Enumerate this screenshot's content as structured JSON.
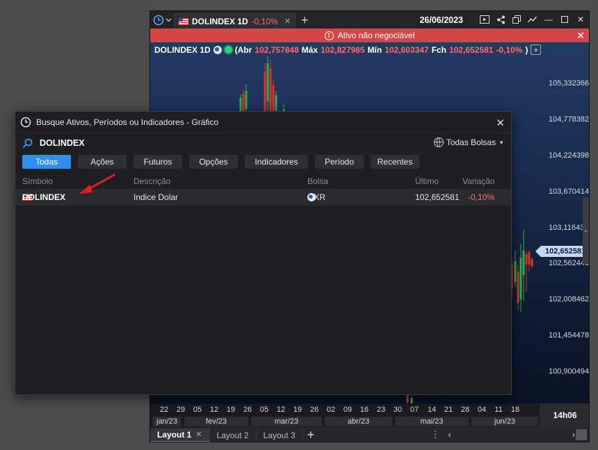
{
  "chart_window": {
    "tab_title": "DOLINDEX 1D",
    "tab_change": "-0,10%",
    "date": "26/06/2023",
    "alert_text": "Ativo não negociável",
    "info": {
      "symbol": "DOLINDEX 1D",
      "open_label": "(Abr",
      "open_value": "102,757848",
      "high_label": "Máx",
      "high_value": "102,827985",
      "low_label": "Mín",
      "low_value": "102,603347",
      "close_label": "Fch",
      "close_value": "102,652581",
      "change": "-0,10%",
      "close_paren": ")"
    },
    "price_axis": [
      "105,332366",
      "104,778382",
      "104,224398",
      "103,670414",
      "103,11643",
      "102,562446",
      "102,008462",
      "101,454478",
      "100,900494"
    ],
    "current_price": "102,652581",
    "day_labels": [
      "22",
      "29",
      "05",
      "12",
      "19",
      "26",
      "05",
      "12",
      "19",
      "26",
      "02",
      "09",
      "16",
      "23",
      "30",
      "07",
      "14",
      "21",
      "28",
      "04",
      "11",
      "18"
    ],
    "month_labels": [
      "jan/23",
      "fev/23",
      "mar/23",
      "abr/23",
      "mai/23",
      "jun/23"
    ],
    "time_box": "14h06",
    "layouts": [
      "Layout 1",
      "Layout 2",
      "Layout 3"
    ],
    "colors": {
      "up": "#2fb24a",
      "down": "#e0312f",
      "accent": "#2f8ff0",
      "alert": "#d64545"
    }
  },
  "search_dialog": {
    "title": "Busque Ativos, Períodos ou Indicadores - Gráfico",
    "search_value": "DOLINDEX",
    "exchange_filter": "Todas Bolsas",
    "filter_tabs": [
      "Todas",
      "Ações",
      "Futuros",
      "Opções",
      "Indicadores",
      "Período",
      "Recentes"
    ],
    "columns": {
      "symbol": "Símbolo",
      "description": "Descrição",
      "exchange": "Bolsa",
      "last": "Último",
      "change": "Variação"
    },
    "results": [
      {
        "symbol": "DOLINDEX",
        "description": "Indice Dolar",
        "exchange": "OXR",
        "last": "102,652581",
        "change": "-0,10%"
      }
    ]
  }
}
